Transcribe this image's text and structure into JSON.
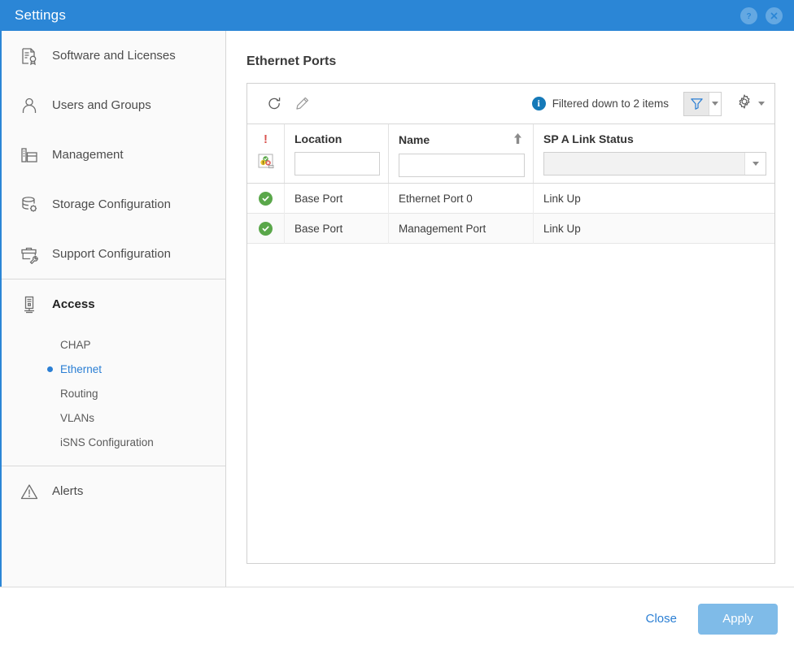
{
  "window": {
    "title": "Settings",
    "help_icon": "help-circle-icon",
    "close_icon": "close-circle-icon",
    "accent_color": "#2b86d6"
  },
  "sidebar": {
    "groups": [
      {
        "items": [
          {
            "label": "Software and Licenses",
            "icon": "license-document-icon"
          },
          {
            "label": "Users and Groups",
            "icon": "user-icon"
          },
          {
            "label": "Management",
            "icon": "management-server-icon"
          },
          {
            "label": "Storage Configuration",
            "icon": "storage-gear-icon"
          },
          {
            "label": "Support Configuration",
            "icon": "toolbox-wrench-icon"
          }
        ]
      },
      {
        "items": [
          {
            "label": "Access",
            "icon": "access-server-icon",
            "active": true
          }
        ],
        "subitems": [
          {
            "label": "CHAP",
            "selected": false
          },
          {
            "label": "Ethernet",
            "selected": true
          },
          {
            "label": "Routing",
            "selected": false
          },
          {
            "label": "VLANs",
            "selected": false
          },
          {
            "label": "iSNS Configuration",
            "selected": false
          }
        ]
      },
      {
        "items": [
          {
            "label": "Alerts",
            "icon": "warning-triangle-icon"
          }
        ]
      }
    ],
    "selected_color": "#2b7fd4"
  },
  "main": {
    "page_title": "Ethernet Ports",
    "toolbar": {
      "refresh_icon": "refresh-icon",
      "edit_icon": "pencil-edit-icon",
      "info_icon": "info-icon",
      "info_badge": "i",
      "filter_message": "Filtered down to 2 items",
      "filter_icon": "funnel-filter-icon",
      "settings_icon": "gear-settings-icon"
    },
    "table": {
      "columns": [
        {
          "key": "status",
          "label": "!",
          "filter_type": "status-icon"
        },
        {
          "key": "location",
          "label": "Location",
          "filter_type": "text",
          "filter_value": ""
        },
        {
          "key": "name",
          "label": "Name",
          "filter_type": "text",
          "filter_value": "",
          "sorted": "asc"
        },
        {
          "key": "link",
          "label": "SP A Link Status",
          "filter_type": "select",
          "filter_value": ""
        }
      ],
      "rows": [
        {
          "status": "ok",
          "location": "Base Port",
          "name": "Ethernet Port 0",
          "link": "Link Up"
        },
        {
          "status": "ok",
          "location": "Base Port",
          "name": "Management Port",
          "link": "Link Up"
        }
      ]
    }
  },
  "footer": {
    "close_label": "Close",
    "apply_label": "Apply"
  }
}
